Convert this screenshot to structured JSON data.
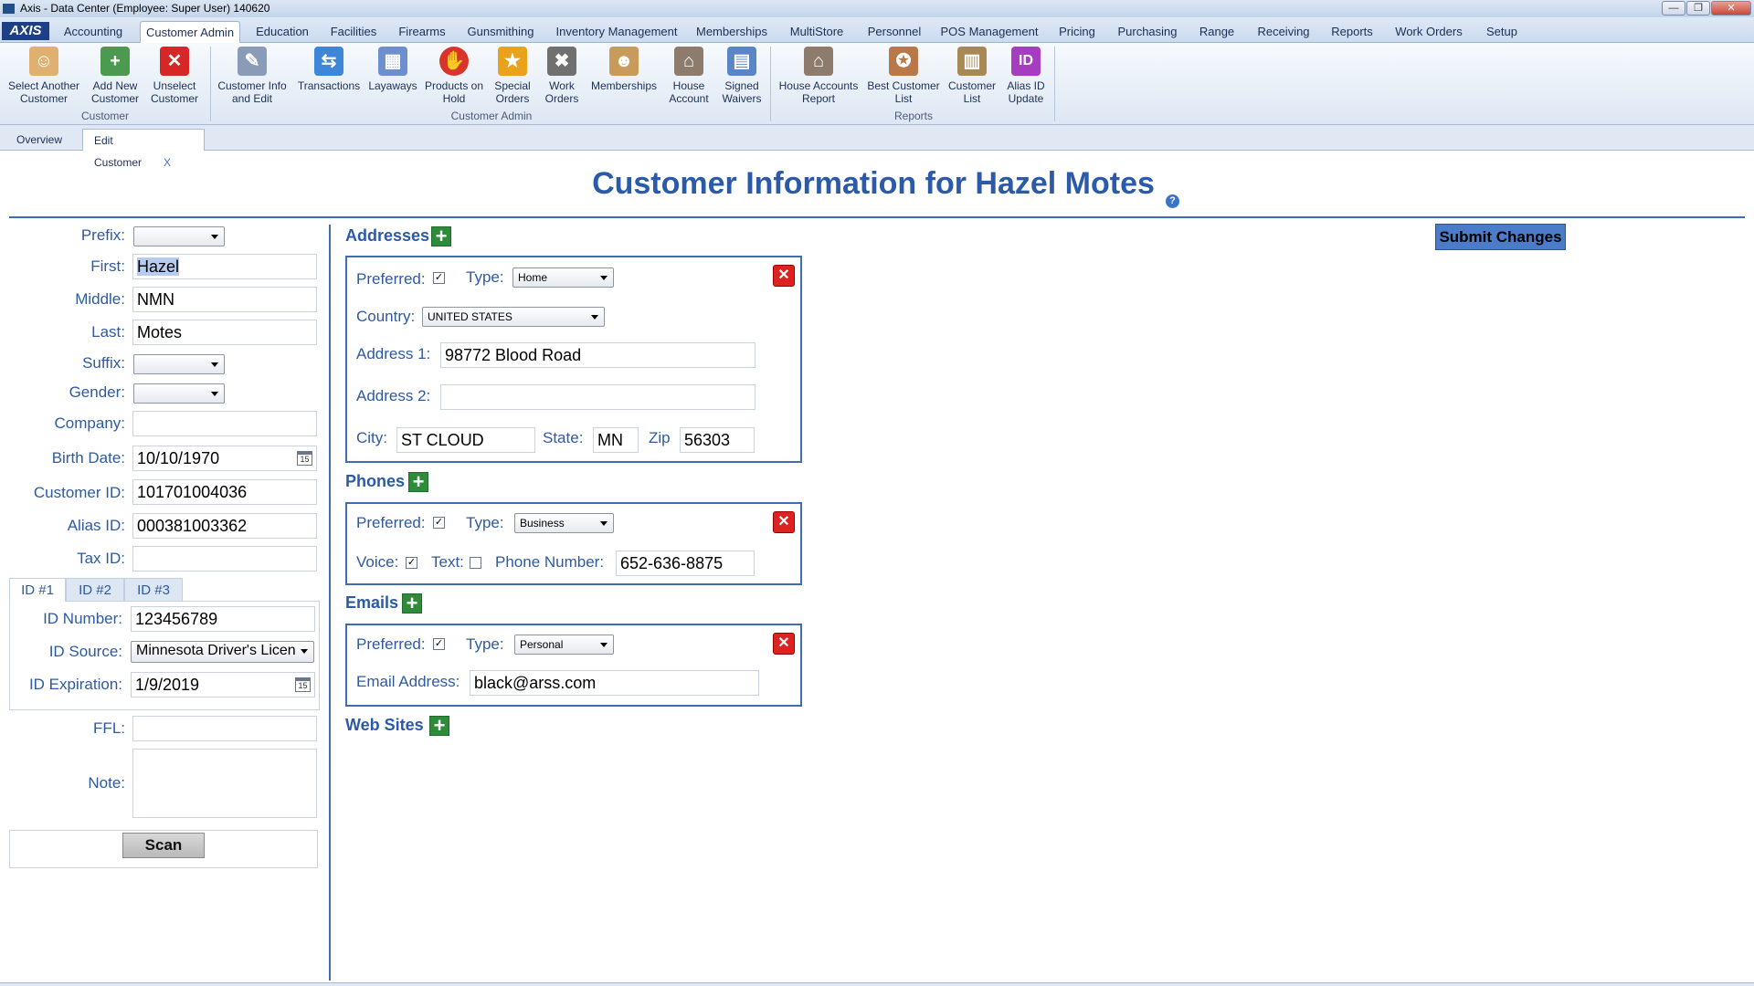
{
  "window": {
    "title": "Axis - Data Center  (Employee: Super User) 140620",
    "min": "—",
    "max": "❐",
    "close": "✕"
  },
  "menu": {
    "logo": "AXIS",
    "tabs": [
      "Accounting",
      "Customer Admin",
      "Education",
      "Facilities",
      "Firearms",
      "Gunsmithing",
      "Inventory Management",
      "Memberships",
      "MultiStore",
      "Personnel",
      "POS Management",
      "Pricing",
      "Purchasing",
      "Range",
      "Receiving",
      "Reports",
      "Work Orders",
      "Setup"
    ],
    "active": "Customer Admin"
  },
  "ribbon": {
    "groups": {
      "customer": "Customer",
      "customer_admin": "Customer Admin",
      "reports": "Reports"
    },
    "buttons": {
      "select_another": "Select Another Customer",
      "add_new": "Add New Customer",
      "unselect": "Unselect Customer",
      "info_edit": "Customer Info and Edit",
      "transactions": "Transactions",
      "layaways": "Layaways",
      "products_hold": "Products on Hold",
      "special_orders": "Special Orders",
      "work_orders": "Work Orders",
      "memberships": "Memberships",
      "house_account": "House Account",
      "signed_waivers": "Signed Waivers",
      "house_accounts_report": "House Accounts Report",
      "best_customer": "Best Customer List",
      "customer_list": "Customer List",
      "alias_update": "Alias ID Update"
    }
  },
  "doctabs": {
    "overview": "Overview",
    "edit": "Edit Customer",
    "close": "X"
  },
  "page": {
    "title": "Customer Information for Hazel Motes",
    "help": "?",
    "submit": "Submit Changes"
  },
  "form": {
    "prefix": {
      "label": "Prefix:",
      "value": ""
    },
    "first": {
      "label": "First:",
      "value": "Hazel"
    },
    "middle": {
      "label": "Middle:",
      "value": "NMN"
    },
    "last": {
      "label": "Last:",
      "value": "Motes"
    },
    "suffix": {
      "label": "Suffix:",
      "value": ""
    },
    "gender": {
      "label": "Gender:",
      "value": ""
    },
    "company": {
      "label": "Company:",
      "value": ""
    },
    "birth": {
      "label": "Birth Date:",
      "value": "10/10/1970"
    },
    "customer_id": {
      "label": "Customer ID:",
      "value": "101701004036"
    },
    "alias_id": {
      "label": "Alias ID:",
      "value": "000381003362"
    },
    "tax_id": {
      "label": "Tax ID:",
      "value": ""
    },
    "id_tabs": [
      "ID #1",
      "ID #2",
      "ID #3"
    ],
    "id_number": {
      "label": "ID Number:",
      "value": "123456789"
    },
    "id_source": {
      "label": "ID Source:",
      "value": "Minnesota Driver's Licen"
    },
    "id_expiration": {
      "label": "ID Expiration:",
      "value": "1/9/2019"
    },
    "ffl": {
      "label": "FFL:",
      "value": ""
    },
    "note": {
      "label": "Note:",
      "value": ""
    },
    "scan": "Scan",
    "cal_icon": "15"
  },
  "addresses": {
    "heading": "Addresses",
    "preferred_label": "Preferred:",
    "preferred": "✓",
    "type_label": "Type:",
    "type": "Home",
    "country_label": "Country:",
    "country": "UNITED STATES",
    "addr1_label": "Address 1:",
    "addr1": "98772 Blood Road",
    "addr2_label": "Address 2:",
    "addr2": "",
    "city_label": "City:",
    "city": "ST CLOUD",
    "state_label": "State:",
    "state": "MN",
    "zip_label": "Zip",
    "zip": "56303"
  },
  "phones": {
    "heading": "Phones",
    "preferred_label": "Preferred:",
    "preferred": "✓",
    "type_label": "Type:",
    "type": "Business",
    "voice_label": "Voice:",
    "voice": "✓",
    "text_label": "Text:",
    "text": "",
    "number_label": "Phone Number:",
    "number": "652-636-8875"
  },
  "emails": {
    "heading": "Emails",
    "preferred_label": "Preferred:",
    "preferred": "✓",
    "type_label": "Type:",
    "type": "Personal",
    "address_label": "Email Address:",
    "address": "black@arss.com"
  },
  "websites": {
    "heading": "Web Sites"
  },
  "glyphs": {
    "plus": "+",
    "del": "✕"
  }
}
